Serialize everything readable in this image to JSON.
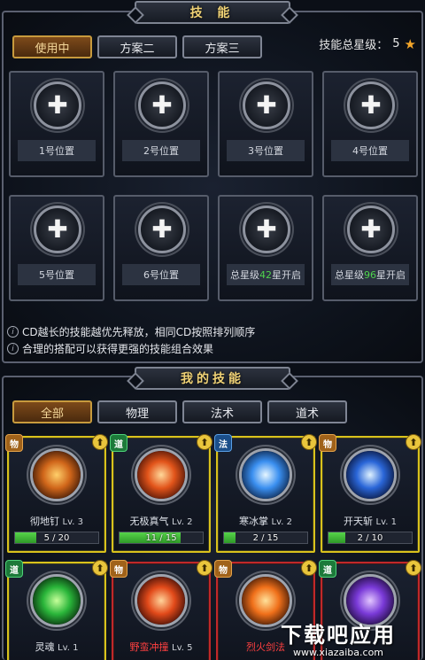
{
  "top": {
    "title": "技 能",
    "tabs": [
      "使用中",
      "方案二",
      "方案三"
    ],
    "star_total_label": "技能总星级：",
    "star_total_value": "5",
    "slots": [
      {
        "label": "1号位置"
      },
      {
        "label": "2号位置"
      },
      {
        "label": "3号位置"
      },
      {
        "label": "4号位置"
      },
      {
        "label": "5号位置"
      },
      {
        "label": "6号位置"
      },
      {
        "pre": "总星级",
        "num": "42",
        "post": "星开启"
      },
      {
        "pre": "总星级",
        "num": "96",
        "post": "星开启"
      }
    ],
    "tips": [
      "CD越长的技能越优先释放，相同CD按照排列顺序",
      "合理的搭配可以获得更强的技能组合效果"
    ]
  },
  "bottom": {
    "title": "我的技能",
    "tabs": [
      "全部",
      "物理",
      "法术",
      "道术"
    ],
    "cards": [
      {
        "type": "物",
        "name": "彻地钉",
        "lv": "Lv. 3",
        "progress": "5 / 20",
        "fill": 0.25,
        "border": "#d9c21c",
        "art": [
          "#ffcf6a",
          "#d0661a",
          "#2a0e04"
        ]
      },
      {
        "type": "道",
        "name": "无极真气",
        "lv": "Lv. 2",
        "progress": "11 / 15",
        "fill": 0.733,
        "border": "#d9c21c",
        "art": [
          "#ffd89a",
          "#e2541a",
          "#3a0c04"
        ]
      },
      {
        "type": "法",
        "name": "寒冰掌",
        "lv": "Lv. 2",
        "progress": "2 / 15",
        "fill": 0.133,
        "border": "#d9c21c",
        "art": [
          "#e6f6ff",
          "#3a8ff0",
          "#061634"
        ]
      },
      {
        "type": "物",
        "name": "开天斩",
        "lv": "Lv. 1",
        "progress": "2 / 10",
        "fill": 0.2,
        "border": "#d9c21c",
        "art": [
          "#dff2ff",
          "#2a66d8",
          "#050c2a"
        ]
      },
      {
        "type": "道",
        "name": "灵魂",
        "lv": "Lv. 1",
        "border": "#d9c21c",
        "art": [
          "#c6ff9a",
          "#2ab63a",
          "#041a08"
        ]
      },
      {
        "type": "物",
        "name": "野蛮冲撞",
        "lv": "Lv. 5",
        "red": true,
        "border": "#c0282a",
        "art": [
          "#ffd39a",
          "#e24a1a",
          "#2a0604"
        ]
      },
      {
        "type": "物",
        "name": "烈火剑法",
        "lv": "",
        "red": true,
        "border": "#c0282a",
        "art": [
          "#ffe19a",
          "#f0701a",
          "#2a0e04"
        ]
      },
      {
        "type": "道",
        "name": "",
        "lv": "",
        "border": "#c0282a",
        "art": [
          "#e2c6ff",
          "#7a3ad8",
          "#14062a"
        ]
      }
    ]
  },
  "watermark": {
    "main": "下载吧应用",
    "sub": "www.xiazaiba.com"
  }
}
